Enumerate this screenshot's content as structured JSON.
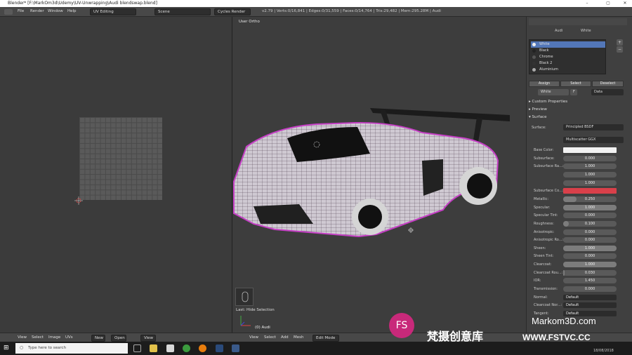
{
  "window": {
    "title": "Blender* [F:\\MarkOm3d\\Udemy\\UV-Unwrapping\\Audi blendswap.blend]"
  },
  "topbar": {
    "menus": [
      "File",
      "Render",
      "Window",
      "Help"
    ],
    "layout": "UV Editing",
    "scene": "Scene",
    "engine": "Cycles Render",
    "stats": "v2.79 | Verts:0/16,841 | Edges:0/31,559 | Faces:0/14,764 | Tris:29,482 | Mem:295.28M | Audi"
  },
  "viewport": {
    "label": "User Ortho",
    "last_op": "Last: Hide Selection",
    "object": "(0) Audi"
  },
  "properties": {
    "breadcrumb": {
      "object": "Audi",
      "material": "White"
    },
    "materials": [
      "White",
      "Black",
      "Chrome",
      "Black 2",
      "Aluminium"
    ],
    "slot_buttons": {
      "assign": "Assign",
      "select": "Select",
      "deselect": "Deselect"
    },
    "material_name": "White",
    "users": "F",
    "link": "Data",
    "sections": {
      "custom": "Custom Properties",
      "preview": "Preview",
      "surface": "Surface"
    },
    "surface_label": "Surface:",
    "surface_value": "Principled BSDF",
    "distribution": "Multiscatter GGX",
    "params": [
      {
        "label": "Base Color:",
        "value": "",
        "color": "#f2f2f2"
      },
      {
        "label": "Subsurface:",
        "value": "0.000",
        "frac": 0
      },
      {
        "label": "Subsurface Ra...:",
        "value": "1.000",
        "frac": 0
      },
      {
        "label": "",
        "value": "1.000",
        "frac": 0
      },
      {
        "label": "",
        "value": "1.000",
        "frac": 0
      },
      {
        "label": "Subsurface Co...:",
        "value": "",
        "color": "#d9404a"
      },
      {
        "label": "Metallic:",
        "value": "0.250",
        "frac": 0.25
      },
      {
        "label": "Specular:",
        "value": "1.000",
        "frac": 1
      },
      {
        "label": "Specular Tint:",
        "value": "0.000",
        "frac": 0
      },
      {
        "label": "Roughness:",
        "value": "0.100",
        "frac": 0.1
      },
      {
        "label": "Anisotropic:",
        "value": "0.000",
        "frac": 0
      },
      {
        "label": "Anisotropic Ro...:",
        "value": "0.000",
        "frac": 0
      },
      {
        "label": "Sheen:",
        "value": "1.000",
        "frac": 1
      },
      {
        "label": "Sheen Tint:",
        "value": "0.000",
        "frac": 0
      },
      {
        "label": "Clearcoat:",
        "value": "1.000",
        "frac": 1
      },
      {
        "label": "Clearcoat Rou...:",
        "value": "0.030",
        "frac": 0.03
      },
      {
        "label": "IOR:",
        "value": "1.450",
        "frac": 0
      },
      {
        "label": "Transmission:",
        "value": "0.000",
        "frac": 0
      },
      {
        "label": "Normal:",
        "value": "Default",
        "frac": 0
      },
      {
        "label": "Clearcoat Nor...:",
        "value": "Default",
        "frac": 0
      },
      {
        "label": "Tangent:",
        "value": "Default",
        "frac": 0
      }
    ]
  },
  "bottombar": {
    "uv_menus": [
      "View",
      "Select",
      "Image",
      "UVs"
    ],
    "new": "New",
    "open": "Open",
    "view": "View",
    "vp_menus": [
      "View",
      "Select",
      "Add",
      "Mesh"
    ],
    "mode": "Edit Mode"
  },
  "taskbar": {
    "search": "Type here to search",
    "date": "18/08/2018"
  },
  "watermark": {
    "brand": "Markom3D.com",
    "cn": "梵摄创意库",
    "site": "WWW.FSTVC.CC",
    "logo": "FS"
  }
}
